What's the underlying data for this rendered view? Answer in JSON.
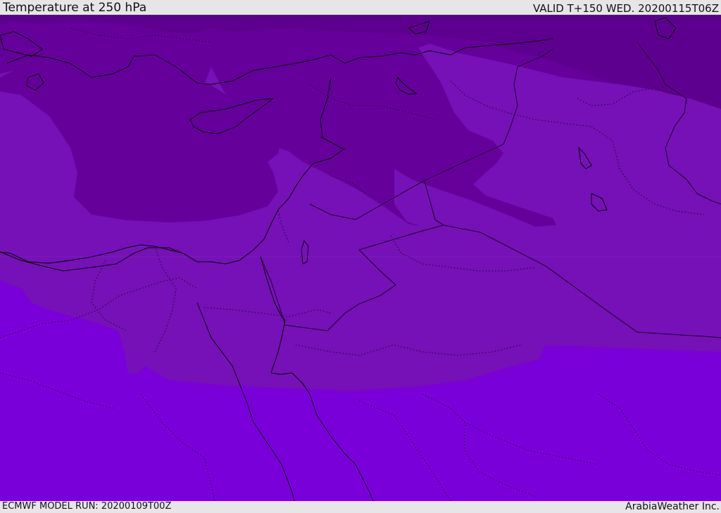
{
  "header": {
    "title": "Temperature at 250 hPa",
    "valid_time": "VALID T+150 WED. 20200115T06Z"
  },
  "footer": {
    "model_run": "ECMWF MODEL RUN: 20200109T00Z",
    "credit": "ArabiaWeather Inc."
  },
  "map": {
    "colors": {
      "deep": "#5e008f",
      "dark": "#65009b",
      "mid": "#7511b6",
      "light": "#7a00da",
      "coast": "#000000",
      "border": "#1a0026"
    }
  }
}
